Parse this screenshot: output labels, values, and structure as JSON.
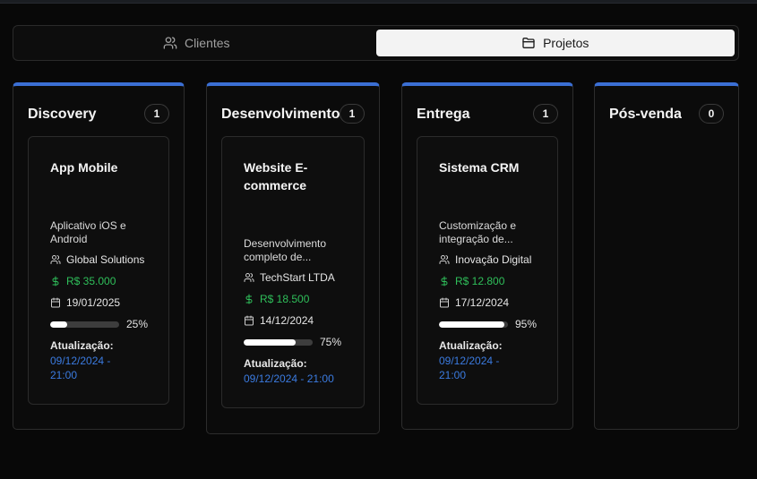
{
  "tabs": [
    {
      "label": "Clientes",
      "icon": "users-icon",
      "active": false
    },
    {
      "label": "Projetos",
      "icon": "folder-icon",
      "active": true
    }
  ],
  "accent_color": "#3b6fd4",
  "columns": [
    {
      "title": "Discovery",
      "count": "1",
      "cards": [
        {
          "title": "App Mobile",
          "description": "Aplicativo iOS e Android",
          "client": "Global Solutions",
          "value": "R$ 35.000",
          "date": "19/01/2025",
          "progress": 25,
          "progress_label": "25%",
          "update_label": "Atualização:",
          "update_value": "09/12/2024 - 21:00"
        }
      ]
    },
    {
      "title": "Desenvolvimento",
      "count": "1",
      "cards": [
        {
          "title": "Website E-commerce",
          "description": "Desenvolvimento completo de...",
          "client": "TechStart LTDA",
          "value": "R$ 18.500",
          "date": "14/12/2024",
          "progress": 75,
          "progress_label": "75%",
          "update_label": "Atualização:",
          "update_value": "09/12/2024 - 21:00"
        }
      ]
    },
    {
      "title": "Entrega",
      "count": "1",
      "cards": [
        {
          "title": "Sistema CRM",
          "description": "Customização e integração de...",
          "client": "Inovação Digital",
          "value": "R$ 12.800",
          "date": "17/12/2024",
          "progress": 95,
          "progress_label": "95%",
          "update_label": "Atualização:",
          "update_value": "09/12/2024 - 21:00"
        }
      ]
    },
    {
      "title": "Pós-venda",
      "count": "0",
      "cards": []
    }
  ]
}
